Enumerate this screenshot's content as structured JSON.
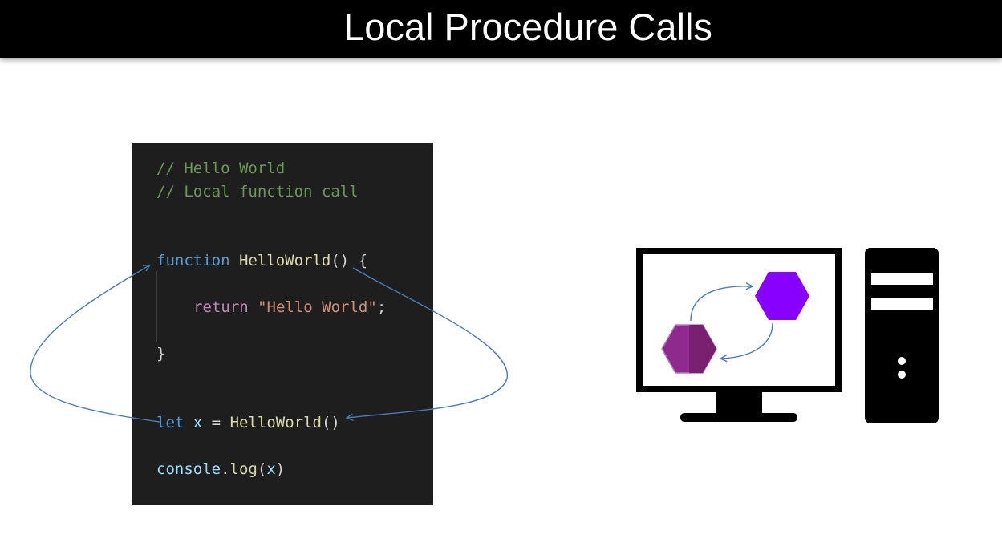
{
  "slide": {
    "title": "Local Procedure Calls"
  },
  "code": {
    "comment_1": "// Hello World",
    "comment_2": "// Local function call",
    "func_keyword": "function",
    "func_name": "HelloWorld",
    "func_parens": "() {",
    "return_keyword": "return",
    "return_string": "\"Hello World\"",
    "return_semicolon": ";",
    "close_brace": "}",
    "let_keyword": "let",
    "var_name": "x",
    "assign_op": " = ",
    "call_name": "HelloWorld",
    "call_parens": "()",
    "console_obj": "console",
    "dot": ".",
    "log_fn": "log",
    "log_args_open": "(",
    "log_arg": "x",
    "log_args_close": ")"
  },
  "illustration": {
    "monitor_icon": "monitor-icon",
    "tower_icon": "computer-tower-icon",
    "process_a_icon": "hexagon-icon",
    "process_b_icon": "hexagon-icon"
  },
  "colors": {
    "code_background": "#1e1e1e",
    "comment": "#6a9955",
    "keyword": "#569cd6",
    "function_name": "#dcdcaa",
    "control_keyword": "#c586c0",
    "string": "#ce9178",
    "variable": "#9cdcfe",
    "arrow": "#4a7ab5",
    "hexagon_bright": "#8800ff",
    "hexagon_muted": "#8e2a8e"
  }
}
